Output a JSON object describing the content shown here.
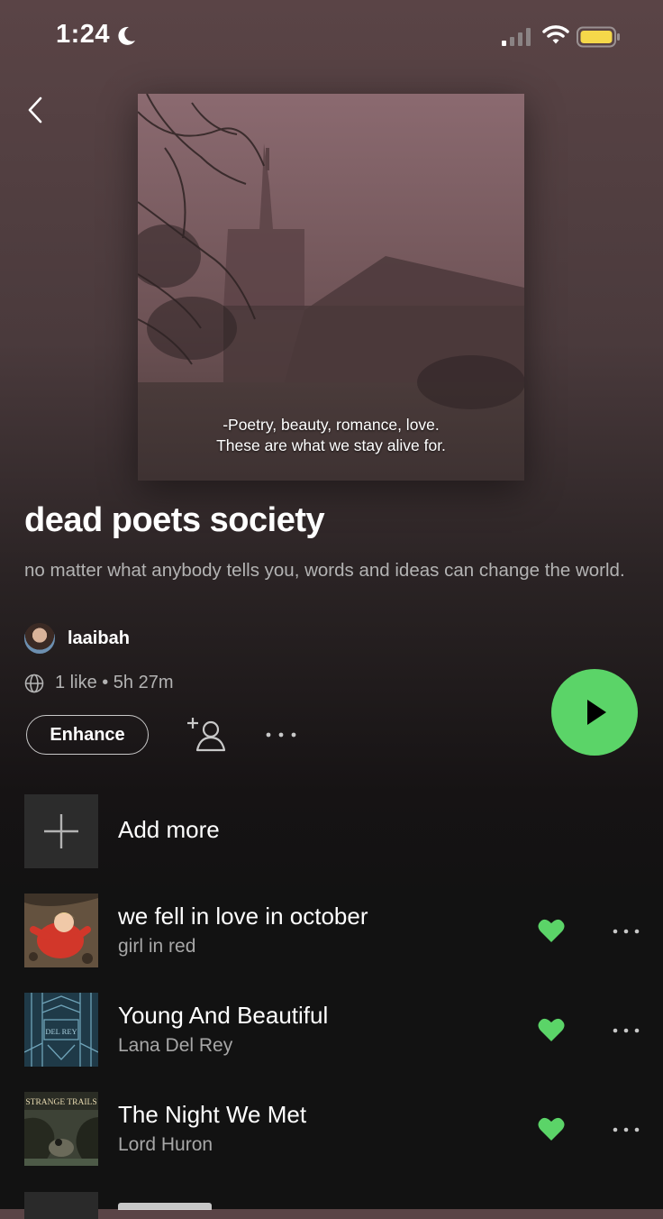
{
  "status_bar": {
    "time": "1:24"
  },
  "playlist": {
    "cover_caption_line1": "-Poetry, beauty, romance, love.",
    "cover_caption_line2": "These are what we stay alive for.",
    "title": "dead poets society",
    "description": "no matter what anybody tells you, words and ideas can change the world.",
    "owner": "laaibah",
    "stats": "1 like • 5h 27m"
  },
  "actions": {
    "enhance_label": "Enhance"
  },
  "add_more_label": "Add more",
  "songs": [
    {
      "title": "we fell in love in october",
      "artist": "girl in red"
    },
    {
      "title": "Young And Beautiful",
      "artist": "Lana Del Rey"
    },
    {
      "title": "The Night We Met",
      "artist": "Lord Huron"
    }
  ],
  "thumb_texts": {
    "lana": "DEL REY",
    "huron": "STRANGE TRAILS"
  },
  "colors": {
    "accent": "#5bd468",
    "background": "#121212",
    "secondary_text": "#b3b3b3"
  },
  "icons": [
    "moon-icon",
    "signal-icon",
    "wifi-icon",
    "battery-icon",
    "back-chevron-icon",
    "globe-icon",
    "play-icon",
    "add-user-icon",
    "more-icon",
    "plus-icon",
    "heart-icon"
  ]
}
